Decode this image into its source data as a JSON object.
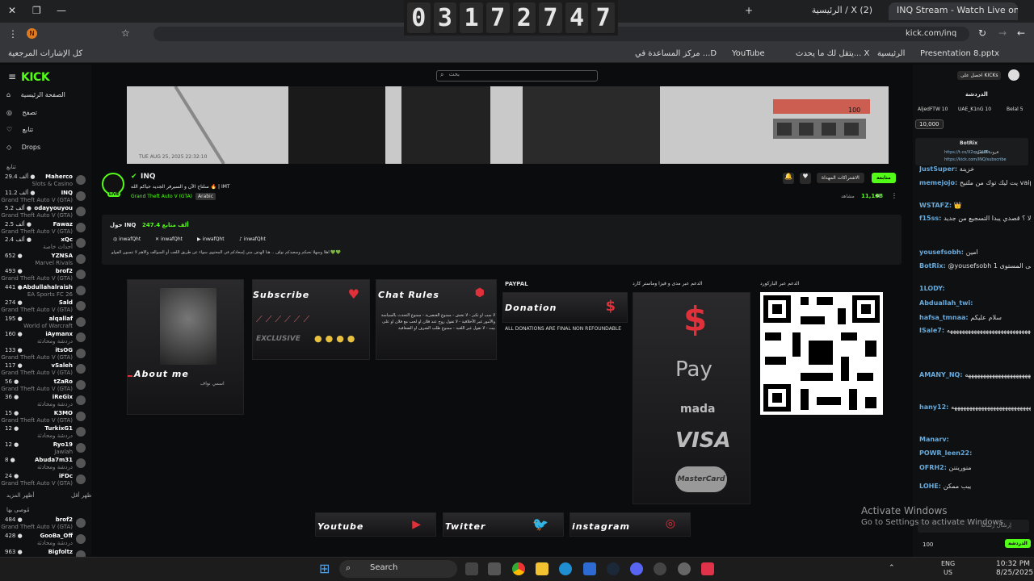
{
  "browser": {
    "tabs": [
      "INQ Stream - Watch Live on",
      "الرئيسية / X (2)"
    ],
    "url": "kick.com/inq",
    "bookmarks": [
      "كل الإشارات المرجعية",
      "مركز المساعدة في ...D",
      "YouTube",
      "يتقل لك ما يحدث... X",
      "الرئيسية",
      "Presentation 8.pptx"
    ]
  },
  "timer": {
    "digits": [
      "0",
      "3",
      "1",
      "7",
      "2",
      "7",
      "4",
      "7"
    ]
  },
  "kick": {
    "logo": "KICK",
    "search_placeholder": "بحث",
    "get_kicks": "احصل على KICKs",
    "nav": [
      "الصفحة الرئيسية",
      "تصفح",
      "تتابع",
      "Drops"
    ],
    "following_label": "تتابع",
    "show_more": "أظهر المزيد",
    "show_less": "أظهر أقل",
    "recommended_label": "مُوصى بها",
    "channels": [
      {
        "name": "Maherco",
        "viewers": "29.4 ألف",
        "game": "Slots & Casino"
      },
      {
        "name": "INQ",
        "viewers": "11.2 ألف",
        "game": "Grand Theft Auto V (GTA)"
      },
      {
        "name": "odayyouyou",
        "viewers": "5.2 ألف",
        "game": "Grand Theft Auto V (GTA)"
      },
      {
        "name": "Fawaz",
        "viewers": "2.5 ألف",
        "game": "Grand Theft Auto V (GTA)"
      },
      {
        "name": "xQc",
        "viewers": "2.4 ألف",
        "game": "أحداث خاصة"
      },
      {
        "name": "YZNSA",
        "viewers": "652",
        "game": "Marvel Rivals"
      },
      {
        "name": "brof2",
        "viewers": "493",
        "game": "Grand Theft Auto V (GTA)"
      },
      {
        "name": "Abdullahalraish",
        "viewers": "441",
        "game": "EA Sports FC 26"
      },
      {
        "name": "Sald",
        "viewers": "274",
        "game": "Grand Theft Auto V (GTA)"
      },
      {
        "name": "alqallaf",
        "viewers": "195",
        "game": "World of Warcraft"
      },
      {
        "name": "iAymanx",
        "viewers": "160",
        "game": "دردشة ومحادثة"
      },
      {
        "name": "itsOG",
        "viewers": "133",
        "game": "Grand Theft Auto V (GTA)"
      },
      {
        "name": "vSaleh",
        "viewers": "117",
        "game": "Grand Theft Auto V (GTA)"
      },
      {
        "name": "tZaRo",
        "viewers": "56",
        "game": "Grand Theft Auto V (GTA)"
      },
      {
        "name": "iReGix",
        "viewers": "36",
        "game": "دردشة ومحادثة"
      },
      {
        "name": "K3MO",
        "viewers": "15",
        "game": "Grand Theft Auto V (GTA)"
      },
      {
        "name": "TurkixG1",
        "viewers": "12",
        "game": "دردشة ومحادثة"
      },
      {
        "name": "Ryo19",
        "viewers": "12",
        "game": "Jawlah"
      },
      {
        "name": "Abuda7m31",
        "viewers": "8",
        "game": "دردشة ومحادثة"
      },
      {
        "name": "iFDc",
        "viewers": "24",
        "game": "Grand Theft Auto V (GTA)"
      }
    ],
    "recommended": [
      {
        "name": "brof2",
        "viewers": "484",
        "game": "Grand Theft Auto V (GTA)"
      },
      {
        "name": "GooBa_Off",
        "viewers": "428",
        "game": "دردشة ومحادثة"
      },
      {
        "name": "Bigfoltz",
        "viewers": "963",
        "game": ""
      }
    ],
    "stream": {
      "name": "INQ",
      "title": "سلتاح الآن و السيرفر الجديد حياكم الله 🔥 | IMT",
      "game": "Grand Theft Auto V (GTA)",
      "language": "Arabic",
      "viewers": "11,168",
      "viewers_label": "مشاهد",
      "follow": "متابعة",
      "subscribe": "الاشتراكات المهداة",
      "video_timestamp": "TUE AUG 25, 2025 22:32:10",
      "game_score": "100"
    },
    "about": {
      "followers": "247.4 ألف متابع",
      "about_name": "حول INQ",
      "socials": [
        "inwafQht",
        "inwafQht",
        "inwafQht",
        "inwafQht"
      ],
      "bio": "اهلا وسهلا نحبكم وسعيدكم نواف .. هنا الهدف مني إسعادكم في المحتوى سواء عن طريق اللعب أو السوالف والاهم لا تنسون الفولو 💚💚"
    },
    "panels": {
      "about_me": "About me",
      "about_me_name": "اسمي نواف",
      "subscribe": "Subscribe",
      "exclusive": "EXCLUSIVE",
      "chat_rules": "Chat Rules",
      "chat_rules_text": "لا سب او تكبر - لا تخش - ممنوع العنصرية - ممنوع التحدث بالسياسة والأمور غير الأخلاقية - لا تقول روح عند فلان او لحب مع فلان او على بيت - لا تقول غير اللعبة - ممنوع طلب الشرف او الضعافية",
      "paypal_label": "PAYPAL",
      "donation": "Donation",
      "donation_note": "ALL DONATIONS ARE FINAL NON REFOUNDABLE",
      "cards_label": "الدعم عبر مدى و فيزا وماستر كارد",
      "qr_label": "الدعم عبر الباركورد",
      "pay_logos": [
        "Pay",
        "mada",
        "VISA",
        "MasterCard"
      ],
      "youtube": "Youtube",
      "twitter": "Twitter",
      "instagram": "instagram"
    },
    "chat": {
      "header": "الدردشة",
      "top_gifters": [
        "AljedFTW 10",
        "UAE_K1nG 10",
        "Belal 5"
      ],
      "kicks": "10,000",
      "pinned_user": "BotRix",
      "pinned_links": [
        "https://t.co/X2qxOil89r",
        "https://kick.com/INQ/subscribe"
      ],
      "pinned_label": "قروب الديس",
      "messages": [
        {
          "user": "JustSuper",
          "text": "خزينة"
        },
        {
          "user": "memejojo",
          "text": "يت ليك توك من ملتيح vaip"
        },
        {
          "user": "WSTAFZ",
          "text": "👑"
        },
        {
          "user": "f15ss",
          "text": "بإمكانه الخير الحين وش سالفه السيرتر الجديد يعني ماعاد فيه اسلحه ولا ؟ قصدي يبدا التسجيع من جديد"
        },
        {
          "user": "yousefsobh",
          "text": "امين"
        },
        {
          "user": "BotRix",
          "text": "@yousefsobh مبروك! وصلت إلى المستوى 1"
        },
        {
          "user": "1LODY",
          "text": ""
        },
        {
          "user": "Abduallah_twi",
          "text": ""
        },
        {
          "user": "hafsa_tmnaa",
          "text": "سلام عليكم"
        },
        {
          "user": "ISale7",
          "text": "ههههههههههههههههههههههههههههههههههههههه"
        },
        {
          "user": "AMANY_NQ",
          "text": "ههههههههههههههههههههههههههههههههههههه"
        },
        {
          "user": "hany12",
          "text": "هههههههههههههههههههههههههههههههههههه"
        },
        {
          "user": "Manarv",
          "text": ""
        },
        {
          "user": "POWR_leen22",
          "text": ""
        },
        {
          "user": "OFRH2",
          "text": "منوريننن"
        },
        {
          "user": "LOHE",
          "text": "يبب ممكن"
        }
      ],
      "input_placeholder": "إرسال رسالة",
      "send": "الدردشة",
      "count": "100"
    }
  },
  "windows": {
    "watermark_title": "Activate Windows",
    "watermark_sub": "Go to Settings to activate Windows.",
    "search": "Search",
    "lang": "ENG",
    "region": "US",
    "time": "10:32 PM",
    "date": "8/25/2025"
  }
}
